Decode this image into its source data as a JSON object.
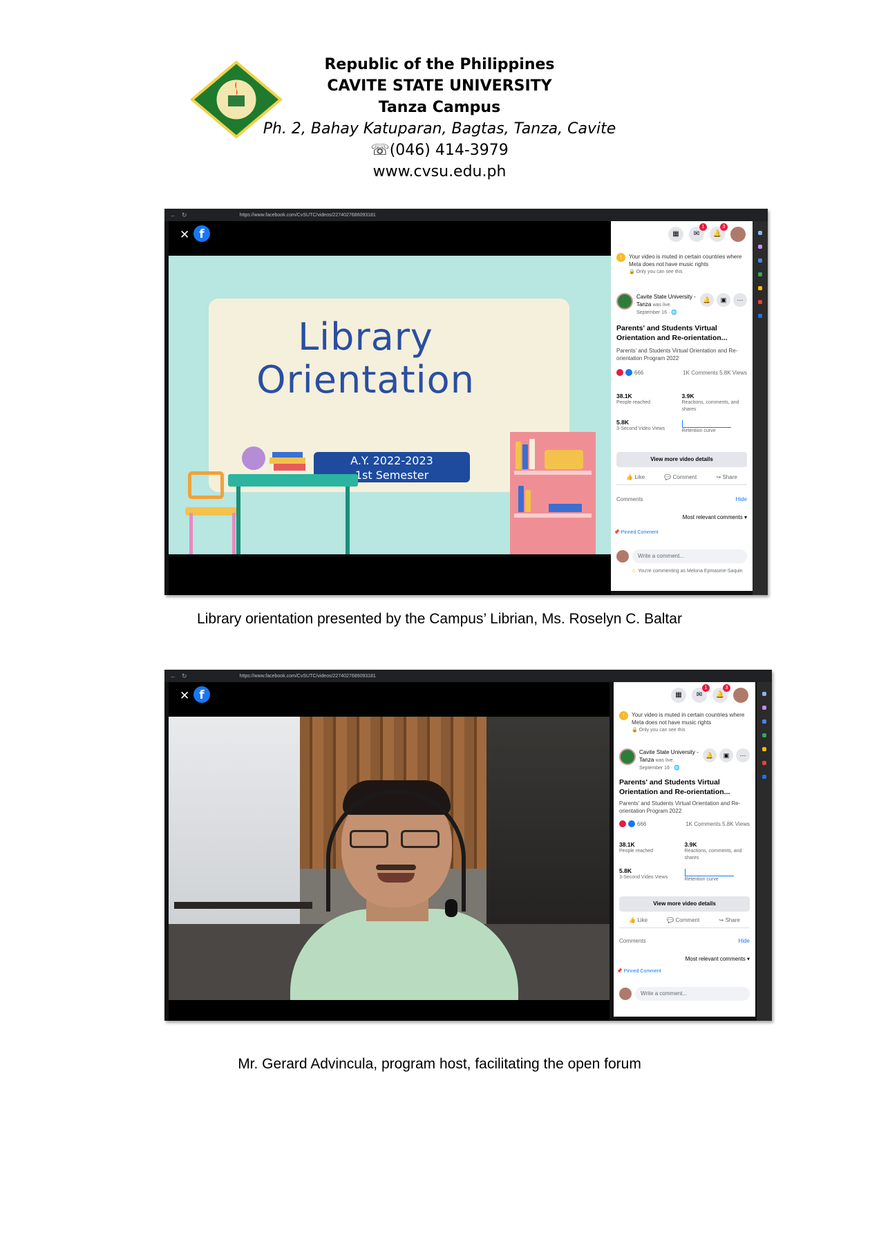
{
  "header": {
    "line1": "Republic of the Philippines",
    "line2": "CAVITE STATE UNIVERSITY",
    "line3": "Tanza Campus",
    "address": "Ph. 2, Bahay Katuparan, Bagtas, Tanza, Cavite",
    "phone": "☏(046) 414-3979",
    "website": "www.cvsu.edu.ph"
  },
  "fb_panel": {
    "url": "https://www.facebook.com/CvSUTC/videos/2274027686093181",
    "muted_notice": "Your video is muted in certain countries where Meta does not have music rights",
    "only_you": "🔒 Only you can see this",
    "page_name": "Cavite State University - Tanza",
    "was_live": "was live.",
    "date": "September 16 · 🌐",
    "title": "Parents' and Students Virtual Orientation and Re-orientation...",
    "description": "Parents' and Students Virtual Orientation and Re-orientation Program 2022",
    "reactions": "666",
    "comments_views": "1K Comments  5.8K Views",
    "people_reached_value": "38.1K",
    "people_reached_label": "People reached",
    "reactions_value": "3.9K",
    "reactions_label": "Reactions, comments, and shares",
    "views_value": "5.8K",
    "views_label": "3-Second Video Views",
    "retention_label": "Retention curve",
    "view_more": "View more video details",
    "like": "Like",
    "comment": "Comment",
    "share": "Share",
    "comments_header": "Comments",
    "hide": "Hide",
    "sort": "Most relevant comments ▾",
    "pinned": "📌 Pinned Comment",
    "write_placeholder": "Write a comment...",
    "commenting_as": "You're commenting as Melona Epmasme-Saquin",
    "badge_messenger": "1",
    "badge_notifications": "3"
  },
  "slide": {
    "title_line1": "Library",
    "title_line2": "Orientation",
    "ay_line1": "A.Y. 2022-2023",
    "ay_line2": "1st Semester"
  },
  "captions": {
    "first": "Library orientation presented by the Campus’ Librian, Ms. Roselyn C. Baltar",
    "second": "Mr. Gerard Advincula, program host, facilitating the open forum"
  },
  "colors": {
    "fb_blue": "#1877f2",
    "slide_bg": "#b8e6e0",
    "slide_title": "#2a4ea3",
    "ay_box": "#1e4b9e"
  }
}
